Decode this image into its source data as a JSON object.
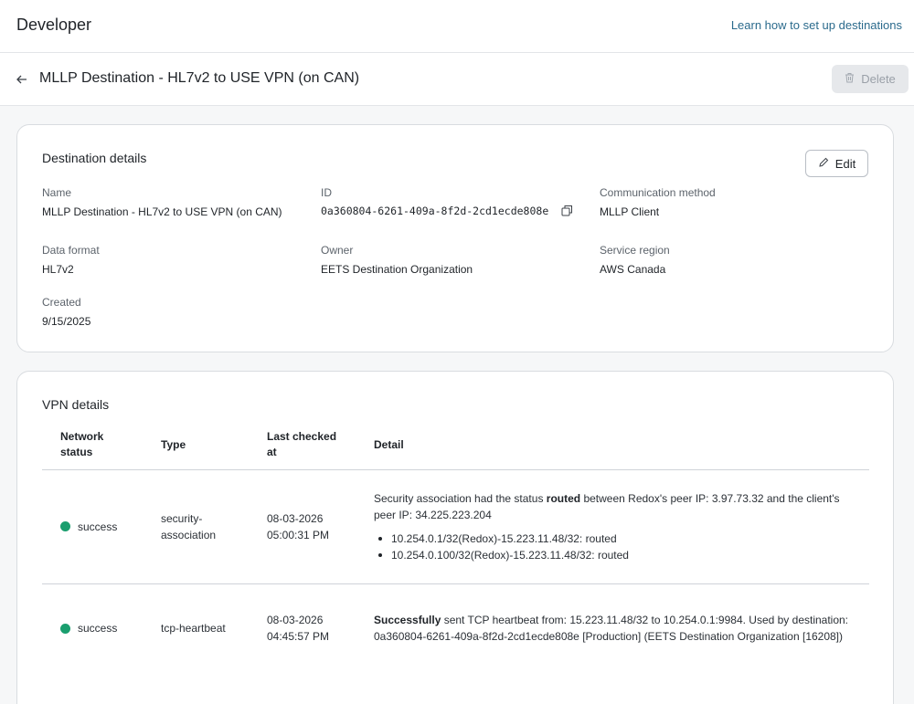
{
  "header": {
    "brand": "Developer",
    "learn_link": "Learn how to set up destinations"
  },
  "subheader": {
    "title": "MLLP Destination - HL7v2 to USE VPN (on CAN)",
    "delete_label": "Delete"
  },
  "destination": {
    "section_title": "Destination details",
    "edit_label": "Edit",
    "name_label": "Name",
    "name_value": "MLLP Destination - HL7v2 to USE VPN (on CAN)",
    "id_label": "ID",
    "id_value": "0a360804-6261-409a-8f2d-2cd1ecde808e",
    "comm_label": "Communication method",
    "comm_value": "MLLP Client",
    "format_label": "Data format",
    "format_value": "HL7v2",
    "owner_label": "Owner",
    "owner_value": "EETS Destination Organization",
    "region_label": "Service region",
    "region_value": "AWS Canada",
    "created_label": "Created",
    "created_value": "9/15/2025"
  },
  "vpn": {
    "section_title": "VPN details",
    "columns": [
      "Network status",
      "Type",
      "Last checked at",
      "Detail"
    ],
    "rows": [
      {
        "status": "success",
        "type": "security-association",
        "checked_date": "08-03-2026",
        "checked_time": "05:00:31 PM",
        "detail_pre": "Security association had the status ",
        "detail_bold": "routed",
        "detail_post": " between Redox's peer IP: 3.97.73.32 and the client's peer IP: 34.225.223.204",
        "bullets": [
          "10.254.0.1/32(Redox)-15.223.11.48/32: routed",
          "10.254.0.100/32(Redox)-15.223.11.48/32: routed"
        ]
      },
      {
        "status": "success",
        "type": "tcp-heartbeat",
        "checked_date": "08-03-2026",
        "checked_time": "04:45:57 PM",
        "detail_bold": "Successfully",
        "detail_post": " sent TCP heartbeat from: 15.223.11.48/32 to 10.254.0.1:9984. Used by destination: 0a360804-6261-409a-8f2d-2cd1ecde808e [Production] (EETS Destination Organization [16208])"
      }
    ]
  },
  "colors": {
    "success": "#1a9e6e",
    "link": "#2a6a8c"
  }
}
